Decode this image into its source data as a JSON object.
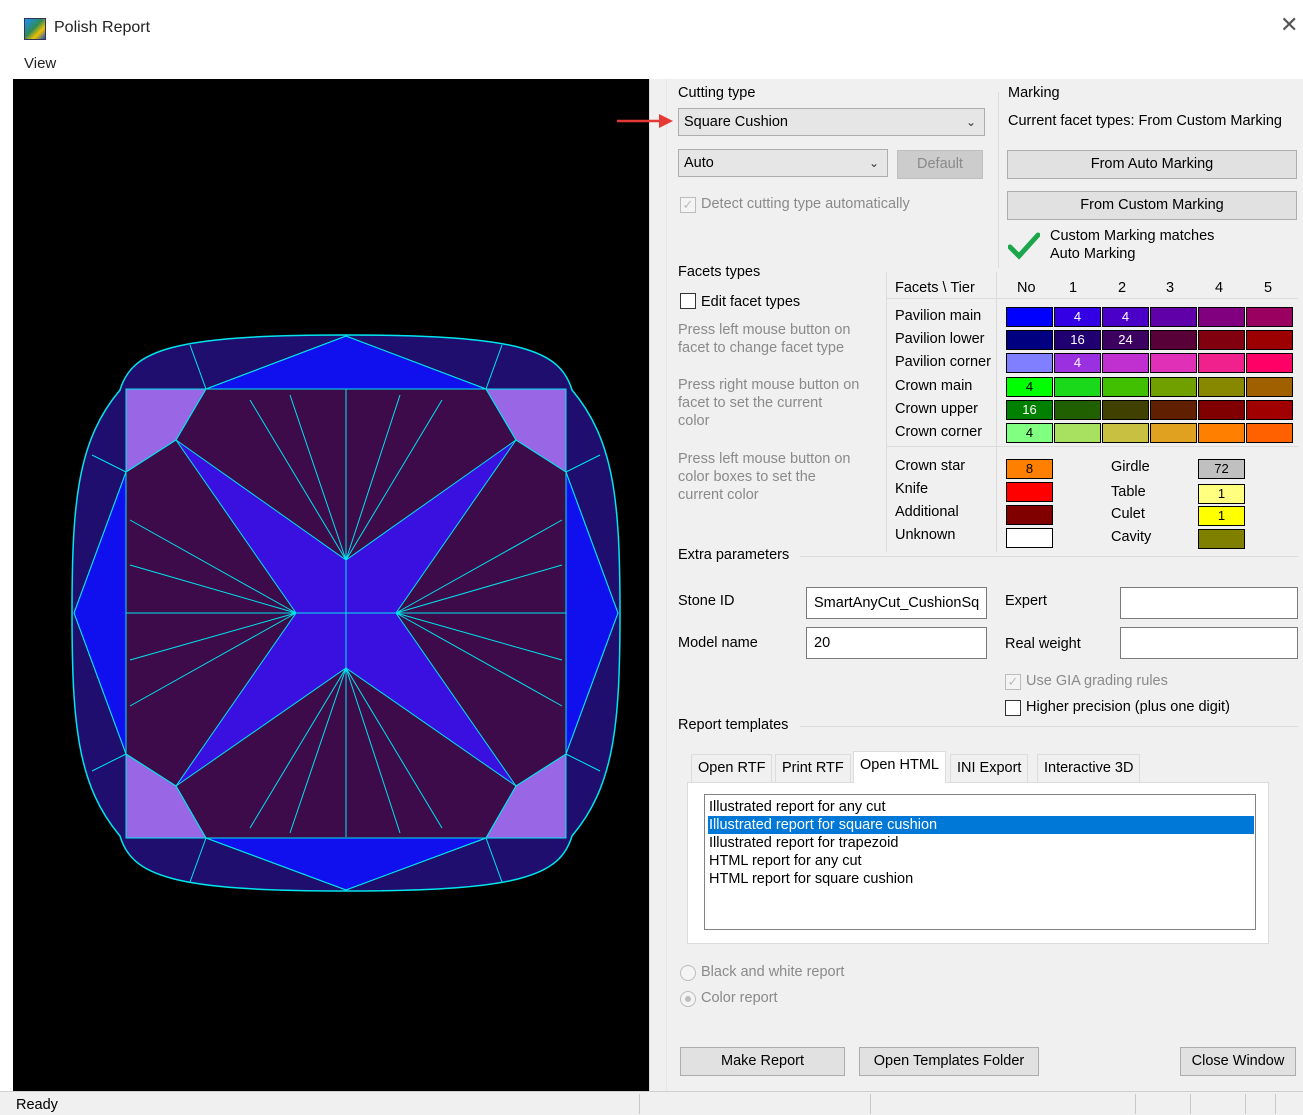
{
  "window": {
    "title": "Polish Report",
    "menu": [
      "View"
    ]
  },
  "cutting_type": {
    "heading": "Cutting type",
    "selected": "Square Cushion",
    "mode": "Auto",
    "default_label": "Default",
    "detect_label": "Detect cutting type automatically"
  },
  "marking": {
    "heading": "Marking",
    "current": "Current facet types: From Custom Marking",
    "from_auto": "From Auto Marking",
    "from_custom": "From Custom Marking",
    "match_line1": "Custom Marking matches",
    "match_line2": "Auto Marking"
  },
  "facets": {
    "heading": "Facets types",
    "edit_label": "Edit facet types",
    "help1": [
      "Press left mouse button on",
      "facet to change facet type"
    ],
    "help2": [
      "Press right mouse button on",
      "facet to set the current",
      "color"
    ],
    "help3": [
      "Press left mouse button on",
      "color boxes to set the",
      "current color"
    ],
    "table_header": "Facets \\ Tier",
    "tiers": [
      "No",
      "1",
      "2",
      "3",
      "4",
      "5"
    ],
    "rows": [
      {
        "name": "Pavilion main",
        "colors": [
          "#0000ff",
          "#3300e6",
          "#4b00c8",
          "#6000a8",
          "#800080",
          "#9a0060"
        ],
        "values": [
          "",
          "4",
          "4",
          "",
          "",
          ""
        ]
      },
      {
        "name": "Pavilion lower",
        "colors": [
          "#000080",
          "#200070",
          "#3c0060",
          "#580038",
          "#800010",
          "#9c0000"
        ],
        "values": [
          "",
          "16",
          "24",
          "",
          "",
          ""
        ]
      },
      {
        "name": "Pavilion corner",
        "colors": [
          "#7f7fff",
          "#9b30e0",
          "#c030d0",
          "#e030b8",
          "#f0208c",
          "#ff0066"
        ],
        "values": [
          "",
          "4",
          "",
          "",
          "",
          ""
        ]
      },
      {
        "name": "Crown main",
        "colors": [
          "#00ff00",
          "#1ad81a",
          "#40c000",
          "#70a000",
          "#888800",
          "#a06000"
        ],
        "values": [
          "4",
          "",
          "",
          "",
          "",
          ""
        ]
      },
      {
        "name": "Crown upper",
        "colors": [
          "#008000",
          "#206000",
          "#404000",
          "#602000",
          "#800000",
          "#a00000"
        ],
        "values": [
          "16",
          "",
          "",
          "",
          "",
          ""
        ]
      },
      {
        "name": "Crown corner",
        "colors": [
          "#80ff80",
          "#a8e060",
          "#c8c040",
          "#e0a020",
          "#ff8000",
          "#ff6000"
        ],
        "values": [
          "4",
          "",
          "",
          "",
          "",
          ""
        ]
      }
    ],
    "extra_left": [
      {
        "name": "Crown star",
        "color": "#ff8000",
        "value": "8"
      },
      {
        "name": "Knife",
        "color": "#ff0000",
        "value": ""
      },
      {
        "name": "Additional",
        "color": "#800000",
        "value": ""
      },
      {
        "name": "Unknown",
        "color": "#ffffff",
        "value": ""
      }
    ],
    "extra_right": [
      {
        "name": "Girdle",
        "color": "#c0c0c0",
        "value": "72"
      },
      {
        "name": "Table",
        "color": "#ffff80",
        "value": "1"
      },
      {
        "name": "Culet",
        "color": "#ffff00",
        "value": "1"
      },
      {
        "name": "Cavity",
        "color": "#808000",
        "value": ""
      }
    ]
  },
  "extra": {
    "heading": "Extra parameters",
    "stone_id_label": "Stone ID",
    "stone_id": "SmartAnyCut_CushionSq",
    "model_name_label": "Model name",
    "model_name": "20",
    "expert_label": "Expert",
    "expert": "",
    "real_weight_label": "Real weight",
    "real_weight": "",
    "gia_label": "Use GIA grading rules",
    "precision_label": "Higher precision (plus one digit)"
  },
  "templates": {
    "heading": "Report templates",
    "tabs": [
      "Open RTF",
      "Print RTF",
      "Open HTML",
      "INI Export",
      "Interactive 3D"
    ],
    "active_tab": "Open HTML",
    "items": [
      "Illustrated report for any cut",
      "Illustrated report for square cushion",
      "Illustrated report for trapezoid",
      "HTML report for any cut",
      "HTML report for square cushion"
    ],
    "selected_index": 1,
    "bw_label": "Black and white report",
    "color_label": "Color report"
  },
  "buttons": {
    "make_report": "Make Report",
    "open_folder": "Open Templates Folder",
    "close": "Close Window"
  },
  "status": {
    "text": "Ready"
  },
  "colors": {
    "facet_outline": "#00e5ee",
    "crown_main": "#1010ee",
    "pavilion_dark": "#3d0a4a",
    "girdle_band": "#1f0e6e",
    "corner": "#9966e6",
    "accent": "#0078d7",
    "check_green": "#1aa64a",
    "arrow_red": "#e53935"
  }
}
